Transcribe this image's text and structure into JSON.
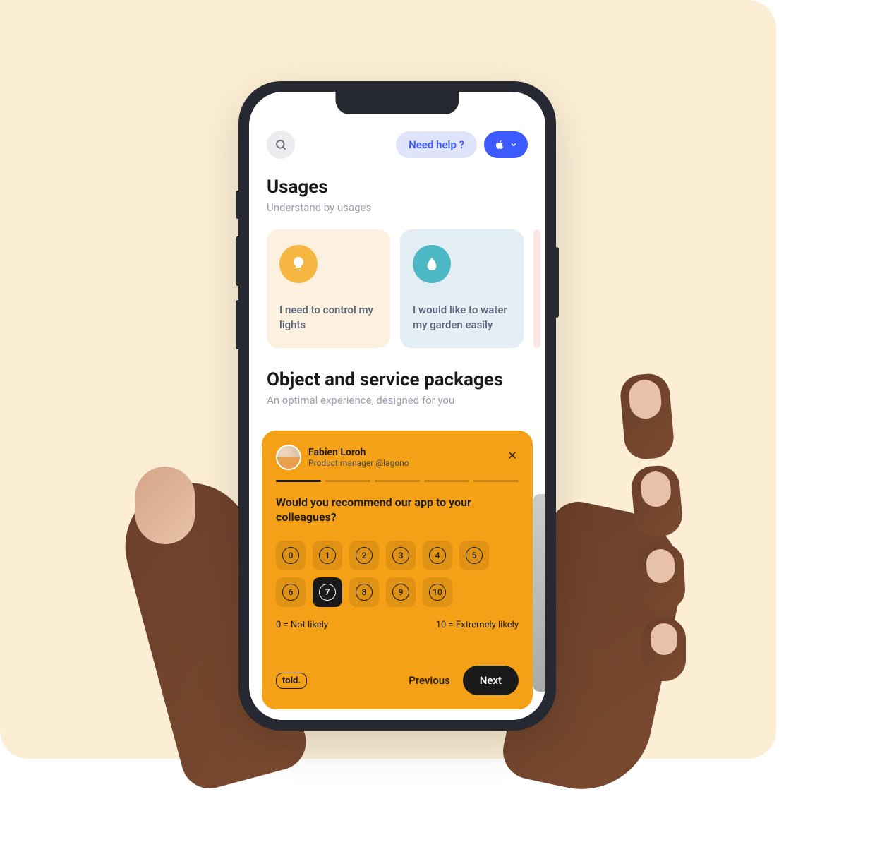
{
  "header": {
    "help_label": "Need help ?"
  },
  "sections": {
    "usages": {
      "title": "Usages",
      "subtitle": "Understand by usages",
      "cards": [
        {
          "text": "I need to control my lights"
        },
        {
          "text": "I would like to water my garden easily"
        }
      ]
    },
    "packages": {
      "title": "Object and service packages",
      "subtitle": "An optimal experience, designed for you"
    }
  },
  "survey": {
    "user": {
      "name": "Fabien Loroh",
      "role": "Product manager @lagono"
    },
    "progress": {
      "current": 1,
      "total": 5
    },
    "question": "Would you recommend our app to your colleagues?",
    "options": [
      "0",
      "1",
      "2",
      "3",
      "4",
      "5",
      "6",
      "7",
      "8",
      "9",
      "10"
    ],
    "selected": "7",
    "min_label": "0 = Not likely",
    "max_label": "10 = Extremely likely",
    "brand": "told.",
    "prev_label": "Previous",
    "next_label": "Next"
  },
  "colors": {
    "accent_orange": "#f4a117",
    "accent_blue": "#3d5afe"
  }
}
